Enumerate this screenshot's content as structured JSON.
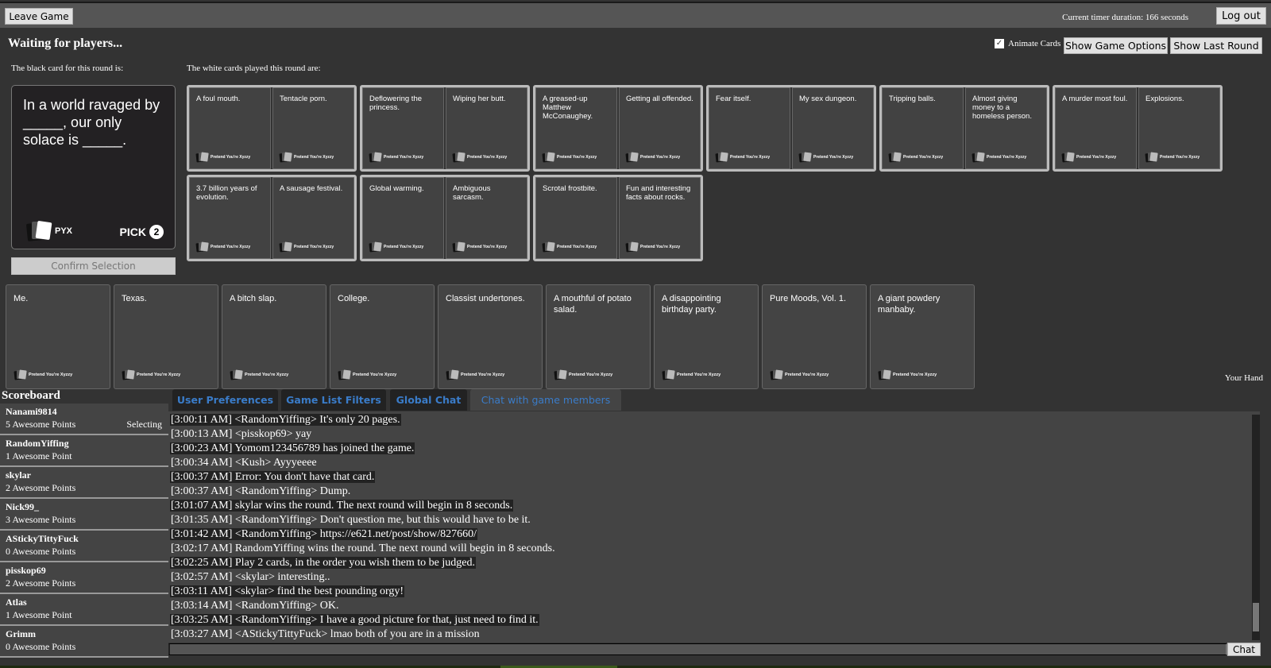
{
  "topbar": {
    "leave_label": "Leave Game",
    "timer_text": "Current timer duration: 166 seconds",
    "logout_label": "Log out"
  },
  "status": {
    "title": "Waiting for players...",
    "animate_label": "Animate Cards",
    "animate_checked": true,
    "game_options_label": "Show Game Options",
    "last_round_label": "Show Last Round"
  },
  "black_card": {
    "label": "The black card for this round is:",
    "text": "In a world ravaged by _____, our only solace is _____.",
    "brand": "PYX",
    "pick_label": "PICK",
    "pick_count": "2"
  },
  "confirm_label": "Confirm Selection",
  "played": {
    "label": "The white cards played this round are:",
    "card_footer": "Pretend You're Xyzzy",
    "groups": [
      [
        "A foul mouth.",
        "Tentacle porn."
      ],
      [
        "Deflowering the princess.",
        "Wiping her butt."
      ],
      [
        "A greased-up Matthew McConaughey.",
        "Getting all offended."
      ],
      [
        "Fear itself.",
        "My sex dungeon."
      ],
      [
        "Tripping balls.",
        "Almost giving money to a homeless person."
      ],
      [
        "A murder most foul.",
        "Explosions."
      ],
      [
        "3.7 billion years of evolution.",
        "A sausage festival."
      ],
      [
        "Global warming.",
        "Ambiguous sarcasm."
      ],
      [
        "Scrotal frostbite.",
        "Fun and interesting facts about rocks."
      ]
    ]
  },
  "hand": {
    "label": "Your Hand",
    "card_footer": "Pretend You're Xyzzy",
    "cards": [
      "Me.",
      "Texas.",
      "A bitch slap.",
      "College.",
      "Classist undertones.",
      "A mouthful of potato salad.",
      "A disappointing birthday party.",
      "Pure Moods, Vol. 1.",
      "A giant powdery manbaby."
    ]
  },
  "scoreboard": {
    "title": "Scoreboard",
    "players": [
      {
        "name": "Nanami9814",
        "points": "5 Awesome Points",
        "status": "Selecting"
      },
      {
        "name": "RandomYiffing",
        "points": "1 Awesome Point",
        "status": ""
      },
      {
        "name": "skylar",
        "points": "2 Awesome Points",
        "status": ""
      },
      {
        "name": "Nick99_",
        "points": "3 Awesome Points",
        "status": ""
      },
      {
        "name": "AStickyTittyFuck",
        "points": "0 Awesome Points",
        "status": ""
      },
      {
        "name": "pisskop69",
        "points": "2 Awesome Points",
        "status": ""
      },
      {
        "name": "Atlas",
        "points": "1 Awesome Point",
        "status": ""
      },
      {
        "name": "Grimm",
        "points": "0 Awesome Points",
        "status": ""
      }
    ]
  },
  "tabs": [
    {
      "label": "User Preferences"
    },
    {
      "label": "Game List Filters"
    },
    {
      "label": "Global Chat"
    },
    {
      "label": "Chat with game members",
      "active": true
    }
  ],
  "chat": {
    "button_label": "Chat",
    "input_value": "",
    "lines": [
      "[3:00:11 AM] <RandomYiffing> It's only 20 pages.",
      "[3:00:13 AM] <pisskop69> yay",
      "[3:00:23 AM] Yomom123456789 has joined the game.",
      "[3:00:34 AM] <Kush> Ayyyeeee",
      "[3:00:37 AM] Error: You don't have that card.",
      "[3:00:37 AM] <RandomYiffing> Dump.",
      "[3:01:07 AM] skylar wins the round. The next round will begin in 8 seconds.",
      "[3:01:35 AM] <RandomYiffing> Don't question me, but this would have to be it.",
      "[3:01:42 AM] <RandomYiffing> https://e621.net/post/show/827660/",
      "[3:02:17 AM] RandomYiffing wins the round. The next round will begin in 8 seconds.",
      "[3:02:25 AM] Play 2 cards, in the order you wish them to be judged.",
      "[3:02:57 AM] <skylar> interesting..",
      "[3:03:11 AM] <skylar> find the best pounding orgy!",
      "[3:03:14 AM] <RandomYiffing> OK.",
      "[3:03:25 AM] <RandomYiffing> I have a good picture for that, just need to find it.",
      "[3:03:27 AM] <AStickyTittyFuck> lmao both of you are in a mission"
    ]
  }
}
